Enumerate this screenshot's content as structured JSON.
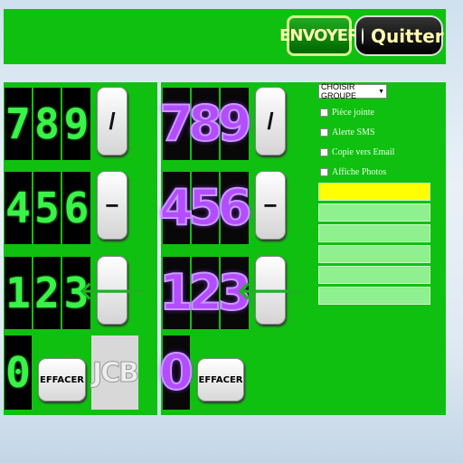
{
  "header": {
    "send_label": "ENVOYER",
    "quit_label": "Quitter"
  },
  "keypad_lcd": {
    "digits": [
      "7",
      "8",
      "9",
      "4",
      "5",
      "6",
      "1",
      "2",
      "3",
      "0"
    ],
    "op_divide": "/",
    "op_minus": "−",
    "op_back": "🡐",
    "clear_label": "EFFACER",
    "captcha_text": "JCB"
  },
  "keypad_neon": {
    "digits": [
      "7",
      "8",
      "9",
      "4",
      "5",
      "6",
      "1",
      "2",
      "3",
      "0"
    ],
    "op_divide": "/",
    "op_minus": "−",
    "op_back": "🡐",
    "clear_label": "EFFACER"
  },
  "options": {
    "group_select": "CHOISIR GROUPE",
    "checkboxes": [
      "Pièce jointe",
      "Alerte SMS",
      "Copie vers Email",
      "Affiche Photos"
    ]
  },
  "colors": {
    "panel": "#10c010",
    "lcd_digit": "#3af24a",
    "neon_digit": "#b44cff",
    "selected_slot": "#ffff00"
  }
}
